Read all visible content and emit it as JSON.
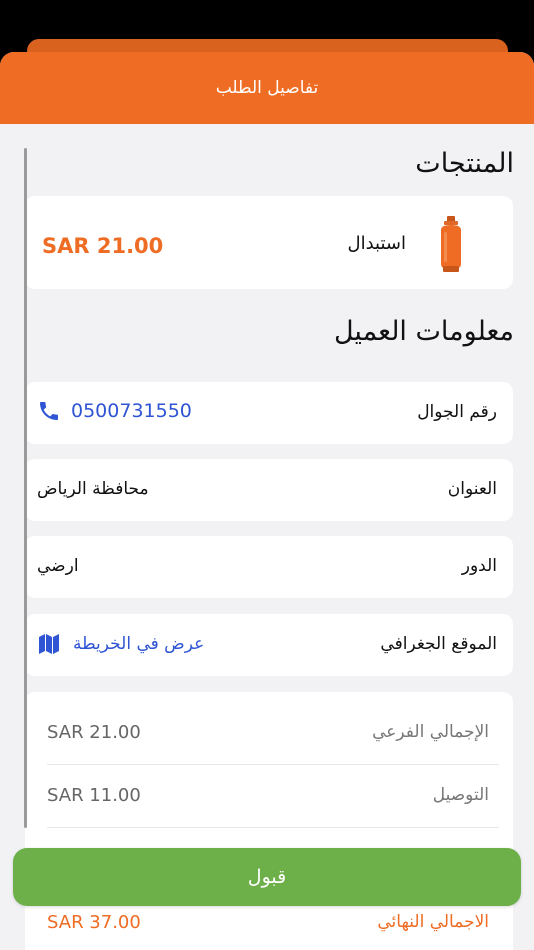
{
  "header": {
    "title": "تفاصيل الطلب"
  },
  "products": {
    "section_title": "المنتجات",
    "items": [
      {
        "name": "استبدال",
        "price": "SAR 21.00",
        "icon": "gas-cylinder-icon"
      }
    ]
  },
  "customer": {
    "section_title": "معلومات العميل",
    "phone": {
      "label": "رقم الجوال",
      "value": "0500731550",
      "icon": "phone-icon"
    },
    "address": {
      "label": "العنوان",
      "value": "محافظة الرياض"
    },
    "floor": {
      "label": "الدور",
      "value": "ارضي"
    },
    "location": {
      "label": "الموقع الجغرافي",
      "link": "عرض في الخريطة",
      "icon": "map-icon"
    }
  },
  "totals": {
    "subtotal": {
      "label": "الإجمالي الفرعي",
      "value": "SAR 21.00"
    },
    "delivery": {
      "label": "التوصيل",
      "value": "SAR 11.00"
    },
    "final": {
      "label": "الاجمالي النهائي",
      "value": "SAR 37.00"
    }
  },
  "actions": {
    "accept_label": "قبول"
  },
  "colors": {
    "accent": "#ee6c23",
    "link": "#2f55d4",
    "accept": "#6db04a"
  }
}
